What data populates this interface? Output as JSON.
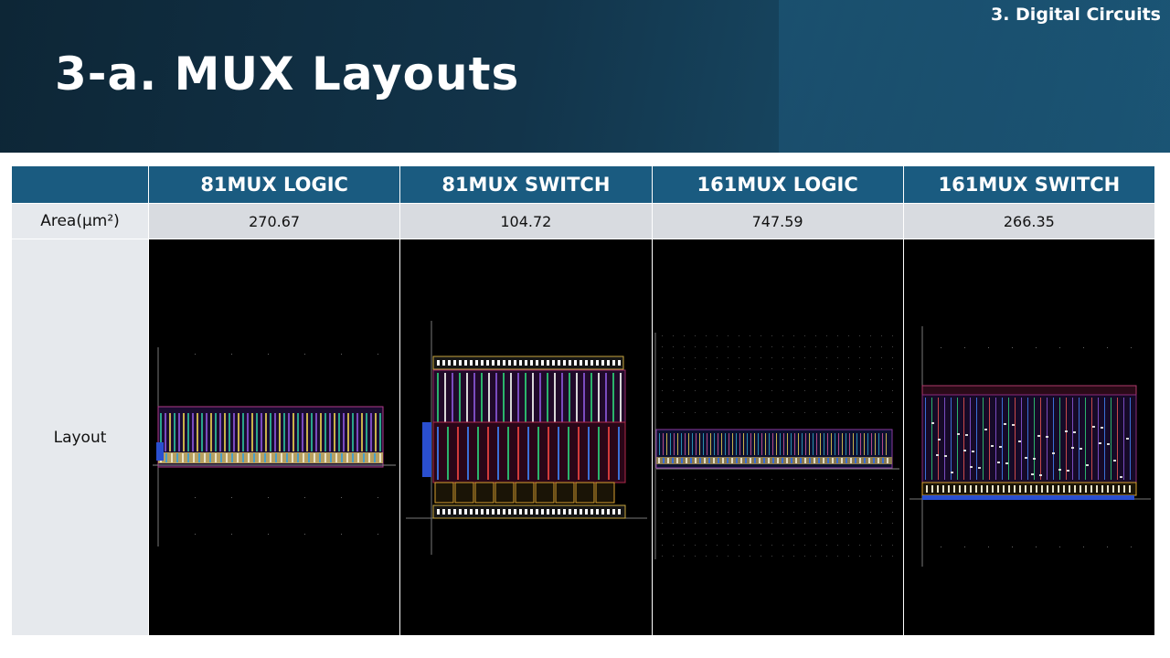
{
  "header": {
    "section": "3. Digital Circuits",
    "title": "3-a. MUX Layouts"
  },
  "table": {
    "columns": [
      "81MUX LOGIC",
      "81MUX SWITCH",
      "161MUX LOGIC",
      "161MUX SWITCH"
    ],
    "area_label": "Area(μm²)",
    "area_values": [
      "270.67",
      "104.72",
      "747.59",
      "266.35"
    ],
    "layout_label": "Layout"
  },
  "colors": {
    "header_bg": "#1a5b80",
    "banner_dark": "#0d2636",
    "layout_bg": "#000000"
  }
}
